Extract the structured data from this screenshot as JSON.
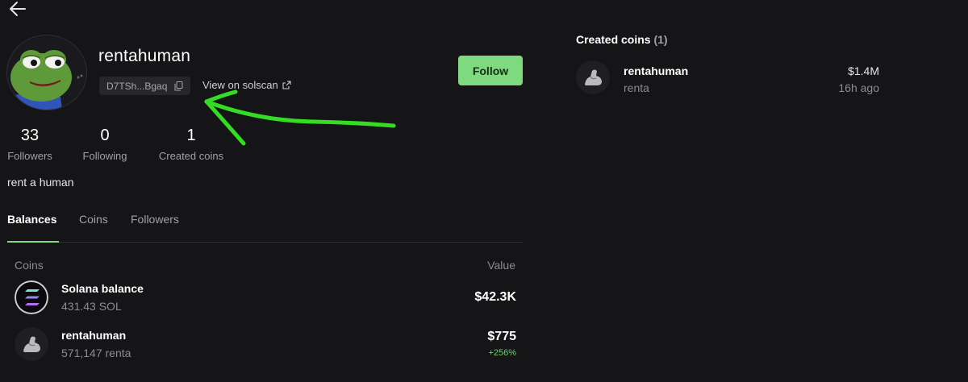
{
  "profile": {
    "username": "rentahuman",
    "address_short": "D7TSh...Bgaq",
    "solscan_label": "View on solscan",
    "follow_label": "Follow",
    "bio": "rent a human"
  },
  "stats": [
    {
      "value": "33",
      "label": "Followers"
    },
    {
      "value": "0",
      "label": "Following"
    },
    {
      "value": "1",
      "label": "Created coins"
    }
  ],
  "tabs": [
    {
      "label": "Balances",
      "active": true
    },
    {
      "label": "Coins",
      "active": false
    },
    {
      "label": "Followers",
      "active": false
    }
  ],
  "balances": {
    "col_coins": "Coins",
    "col_value": "Value",
    "rows": [
      {
        "name": "Solana balance",
        "amount": "431.43 SOL",
        "value": "$42.3K",
        "change": ""
      },
      {
        "name": "rentahuman",
        "amount": "571,147 renta",
        "value": "$775",
        "change": "+256%"
      }
    ]
  },
  "created_coins": {
    "title": "Created coins",
    "count": "(1)",
    "items": [
      {
        "name": "rentahuman",
        "ticker": "renta",
        "market_cap": "$1.4M",
        "age": "16h ago"
      }
    ]
  },
  "colors": {
    "background": "#151518",
    "accent_green": "#7fd97f",
    "annotation_arrow": "#33dd22"
  },
  "icons": {
    "back": "arrow-left-icon",
    "copy": "copy-icon",
    "external": "external-link-icon",
    "solana": "solana-logo-icon",
    "coin": "flexed-arm-icon"
  }
}
